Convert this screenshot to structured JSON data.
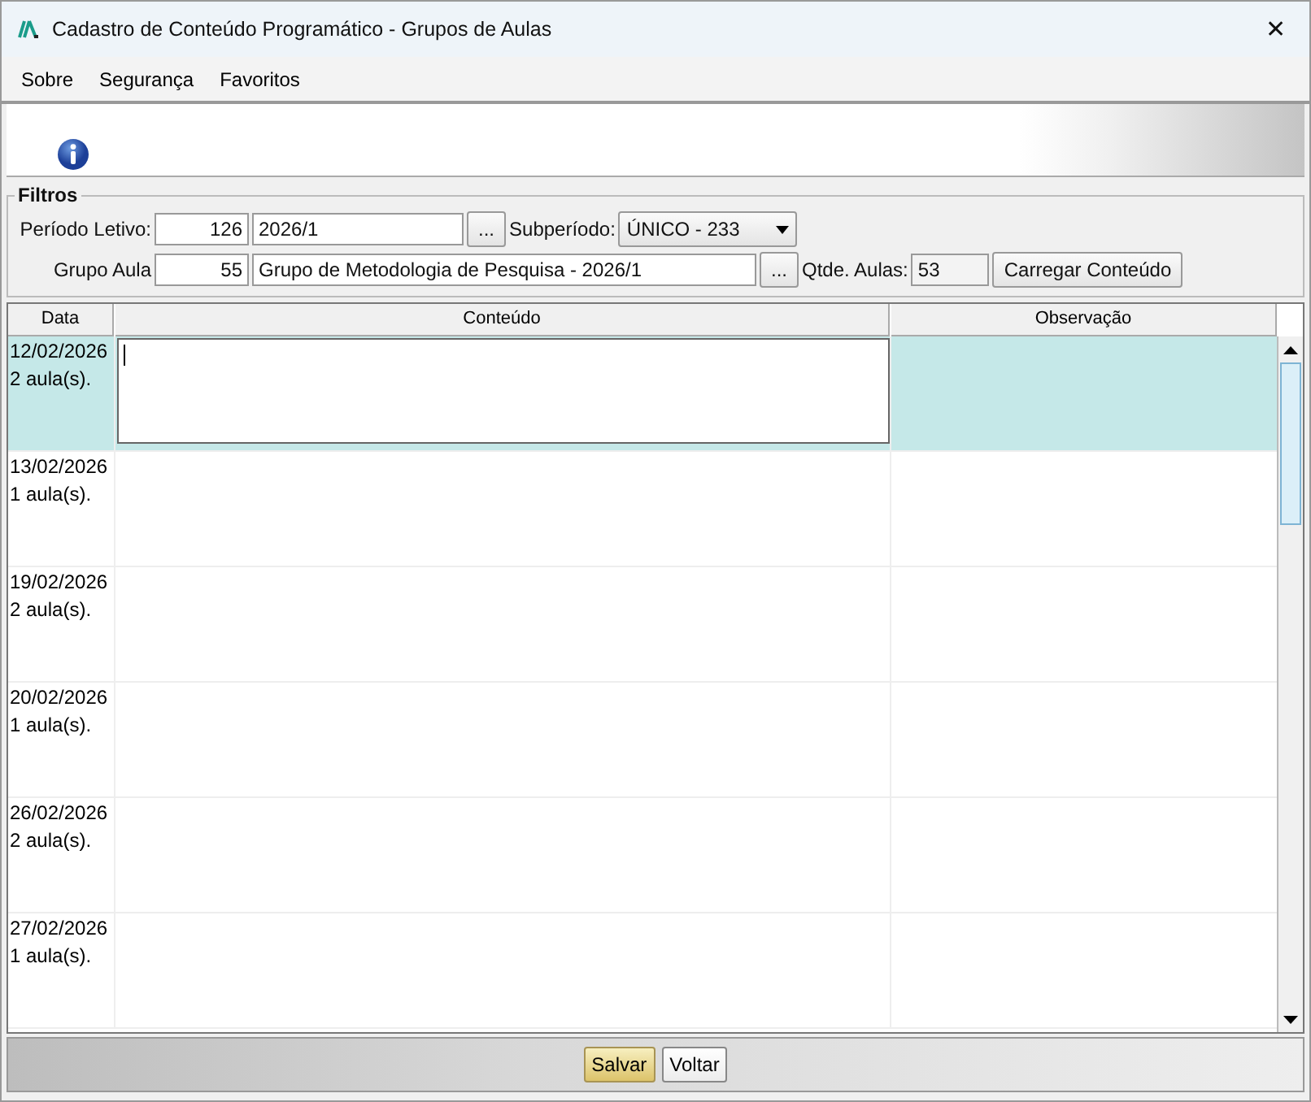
{
  "window": {
    "title": "Cadastro de Conteúdo Programático - Grupos de Aulas",
    "close": "✕"
  },
  "menu": [
    {
      "label": "Sobre"
    },
    {
      "label": "Segurança"
    },
    {
      "label": "Favoritos"
    }
  ],
  "filters": {
    "title": "Filtros",
    "periodo": {
      "label": "Período Letivo:",
      "code": "126",
      "value": "2026/1",
      "lookup": "..."
    },
    "subperiodo": {
      "label": "Subperíodo:",
      "value": "ÚNICO - 233"
    },
    "grupo": {
      "label": "Grupo Aula",
      "code": "55",
      "value": "Grupo de Metodologia de Pesquisa - 2026/1",
      "lookup": "..."
    },
    "qtde": {
      "label": "Qtde. Aulas:",
      "value": "53"
    },
    "load_button": "Carregar Conteúdo"
  },
  "table": {
    "columns": [
      "Data",
      "Conteúdo",
      "Observação"
    ],
    "rows": [
      {
        "date": "12/02/2026",
        "lessons": "2 aula(s).",
        "selected": true
      },
      {
        "date": "13/02/2026",
        "lessons": "1 aula(s).",
        "selected": false
      },
      {
        "date": "19/02/2026",
        "lessons": "2 aula(s).",
        "selected": false
      },
      {
        "date": "20/02/2026",
        "lessons": "1 aula(s).",
        "selected": false
      },
      {
        "date": "26/02/2026",
        "lessons": "2 aula(s).",
        "selected": false
      },
      {
        "date": "27/02/2026",
        "lessons": "1 aula(s).",
        "selected": false
      }
    ]
  },
  "buttons": [
    {
      "label": "Salvar",
      "kind": "primary"
    },
    {
      "label": "Voltar",
      "kind": "normal"
    }
  ]
}
